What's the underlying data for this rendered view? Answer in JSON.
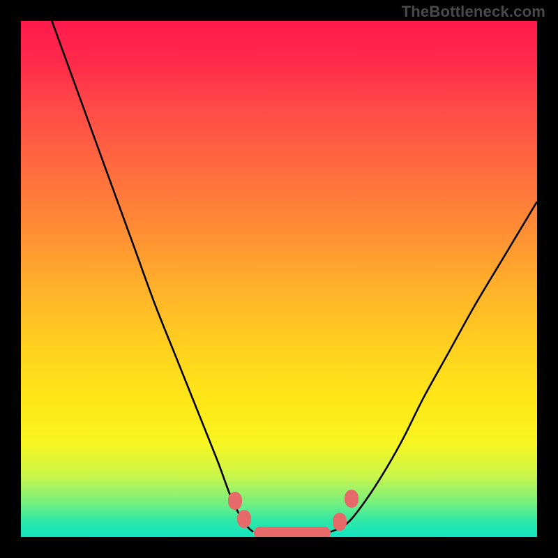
{
  "attribution": "TheBottleneck.com",
  "colors": {
    "marker_fill": "#e66a6a",
    "curve_stroke": "#000000",
    "frame": "#000000"
  },
  "chart_data": {
    "type": "line",
    "title": "",
    "xlabel": "",
    "ylabel": "",
    "xlim": [
      0,
      100
    ],
    "ylim": [
      0,
      100
    ],
    "grid": false,
    "series": [
      {
        "name": "left-curve",
        "x": [
          6,
          10,
          14,
          18,
          22,
          26,
          30,
          34,
          38,
          41,
          43.5,
          45
        ],
        "y": [
          100,
          89,
          78,
          67,
          56,
          45,
          35,
          25,
          15,
          7,
          2.5,
          1
        ]
      },
      {
        "name": "right-curve",
        "x": [
          60,
          63,
          66,
          70,
          74,
          78,
          83,
          88,
          94,
          100
        ],
        "y": [
          1,
          2.5,
          6,
          12,
          19,
          27,
          36,
          45,
          55,
          65
        ]
      },
      {
        "name": "flat-bottom",
        "x": [
          45,
          60
        ],
        "y": [
          1,
          1
        ]
      }
    ],
    "markers": [
      {
        "x": 41.5,
        "y": 7.0,
        "shape": "dot"
      },
      {
        "x": 43.2,
        "y": 3.5,
        "shape": "dot"
      },
      {
        "x": 52.5,
        "y": 0.8,
        "shape": "pill"
      },
      {
        "x": 61.8,
        "y": 3.0,
        "shape": "dot"
      },
      {
        "x": 64.0,
        "y": 7.5,
        "shape": "dot"
      }
    ]
  }
}
